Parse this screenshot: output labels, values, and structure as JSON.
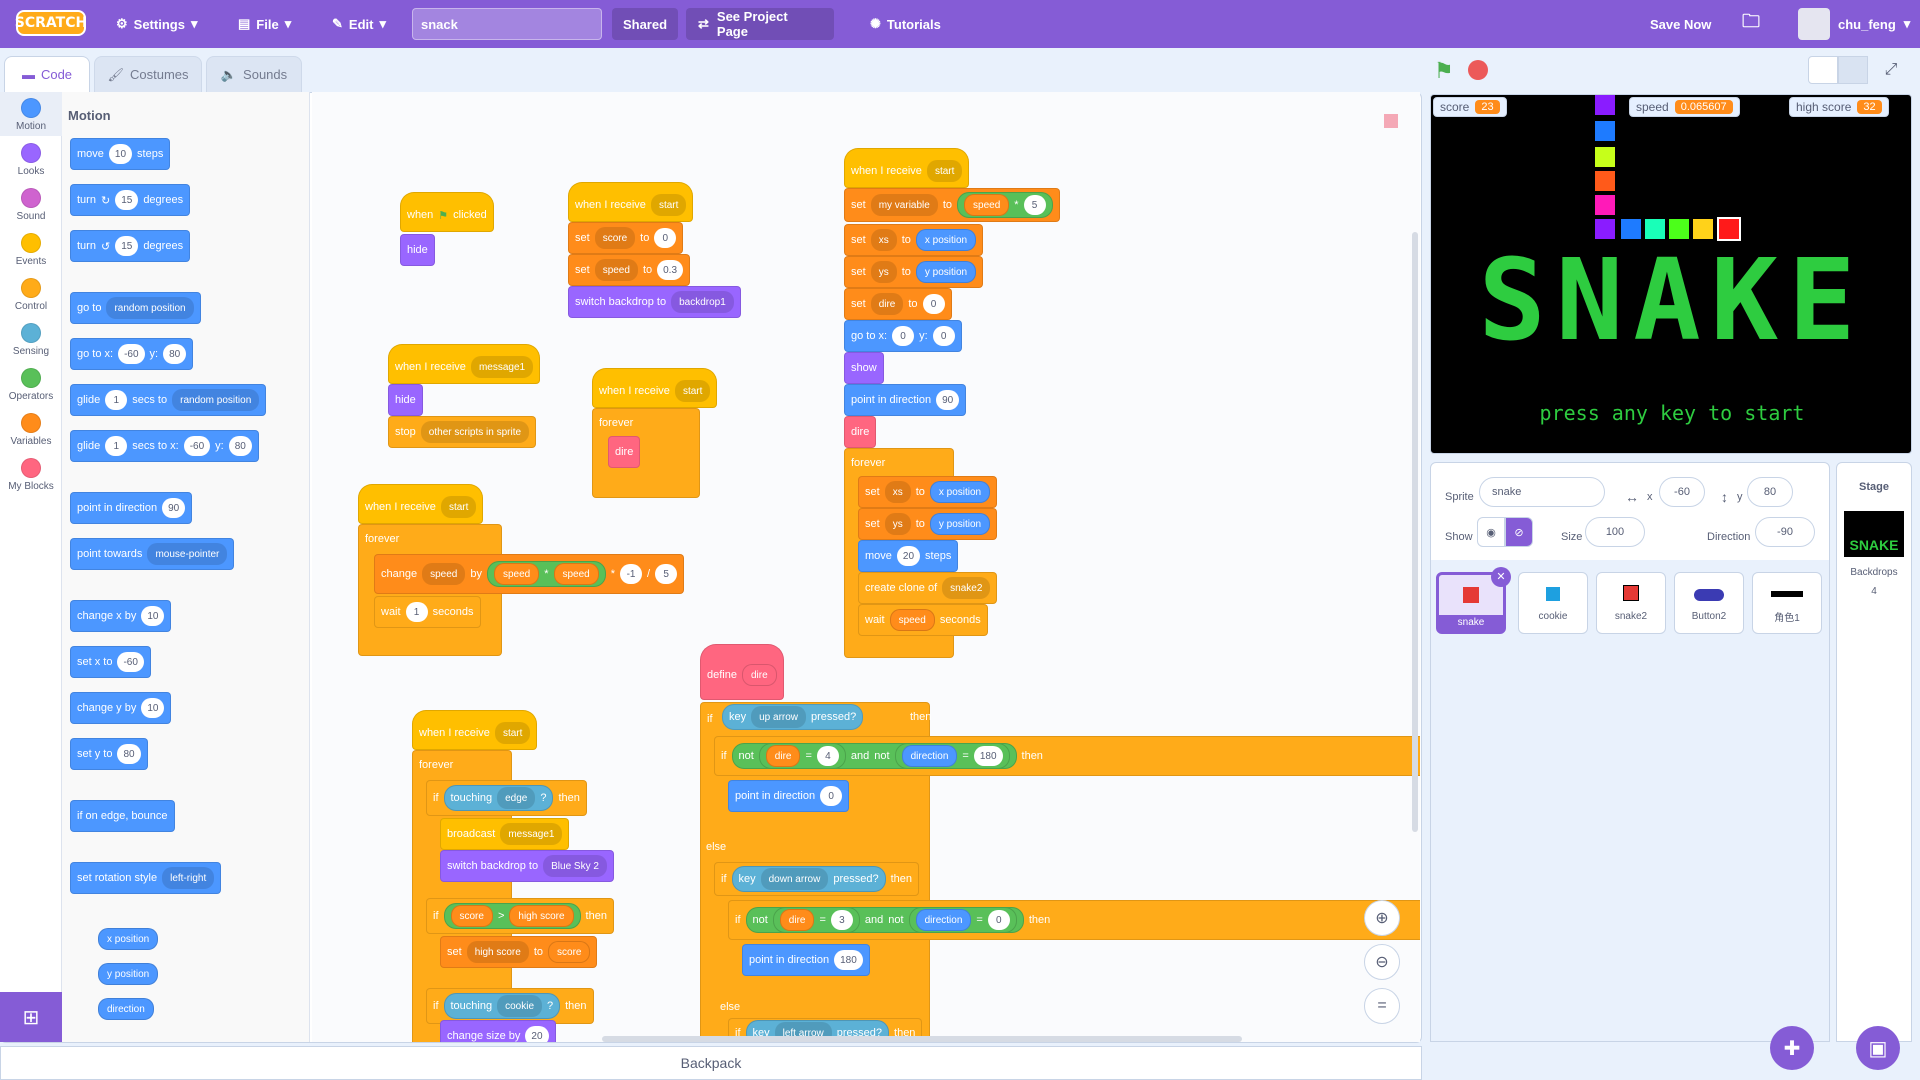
{
  "menubar": {
    "logo": "SCRATCH",
    "settings": "Settings",
    "file": "File",
    "edit": "Edit",
    "project_title": "snack",
    "shared": "Shared",
    "see_project": "See Project Page",
    "tutorials": "Tutorials",
    "save_now": "Save Now",
    "username": "chu_feng"
  },
  "tabs": {
    "code": "Code",
    "costumes": "Costumes",
    "sounds": "Sounds"
  },
  "categories": [
    {
      "label": "Motion",
      "color": "#4c97ff"
    },
    {
      "label": "Looks",
      "color": "#9966ff"
    },
    {
      "label": "Sound",
      "color": "#cf63cf"
    },
    {
      "label": "Events",
      "color": "#ffbf00"
    },
    {
      "label": "Control",
      "color": "#ffab19"
    },
    {
      "label": "Sensing",
      "color": "#5cb1d6"
    },
    {
      "label": "Operators",
      "color": "#59c059"
    },
    {
      "label": "Variables",
      "color": "#ff8c1a"
    },
    {
      "label": "My Blocks",
      "color": "#ff6680"
    }
  ],
  "palette": {
    "heading": "Motion",
    "move": "move",
    "move_n": "10",
    "steps": "steps",
    "turn": "turn",
    "turn_n": "15",
    "degrees": "degrees",
    "goto": "go to",
    "random_position": "random position",
    "goto_x": "go to x:",
    "gx": "-60",
    "y": "y:",
    "gy": "80",
    "glide": "glide",
    "glide_n": "1",
    "secs_to": "secs to",
    "secs_to_x": "secs to x:",
    "point_dir": "point in direction",
    "dir_n": "90",
    "point_towards": "point towards",
    "mouse_pointer": "mouse-pointer",
    "change_x": "change x by",
    "change_x_n": "10",
    "set_x": "set x to",
    "set_x_n": "-60",
    "change_y": "change y by",
    "change_y_n": "10",
    "set_y": "set y to",
    "set_y_n": "80",
    "bounce": "if on edge, bounce",
    "rotation": "set rotation style",
    "left_right": "left-right",
    "xpos": "x position",
    "ypos": "y position",
    "direction": "direction"
  },
  "scripts": {
    "when": "when",
    "clicked": "clicked",
    "hide": "hide",
    "show": "show",
    "when_receive": "when I receive",
    "start": "start",
    "message1": "message1",
    "set": "set",
    "to": "to",
    "score": "score",
    "zero": "0",
    "speed": "speed",
    "speed_v": "0.3",
    "switch_backdrop": "switch backdrop to",
    "backdrop1": "backdrop1",
    "stop": "stop",
    "other_scripts": "other scripts in sprite",
    "forever": "forever",
    "dire": "dire",
    "change": "change",
    "by": "by",
    "times": "*",
    "neg1": "-1",
    "div": "/",
    "five": "5",
    "wait": "wait",
    "one": "1",
    "seconds": "seconds",
    "my_variable": "my variable",
    "xs": "xs",
    "ys": "ys",
    "x_position": "x position",
    "y_position": "y position",
    "goto_x": "go to x:",
    "y_colon": "y:",
    "point_in_direction": "point in direction",
    "ninety": "90",
    "move": "move",
    "twenty": "20",
    "steps": "steps",
    "create_clone": "create clone of",
    "snake2": "snake2",
    "define": "define",
    "if": "if",
    "then": "then",
    "else": "else",
    "touching": "touching",
    "edge": "edge",
    "q": "?",
    "broadcast": "broadcast",
    "blue_sky": "Blue Sky 2",
    "gt": ">",
    "high_score": "high score",
    "cookie": "cookie",
    "change_size": "change size by",
    "size_n": "20",
    "key": "key",
    "up_arrow": "up arrow",
    "down_arrow": "down arrow",
    "left_arrow": "left arrow",
    "pressed": "pressed?",
    "not": "not",
    "eq": "=",
    "four": "4",
    "and": "and",
    "direction": "direction",
    "d180": "180",
    "three": "3"
  },
  "stage": {
    "score_label": "score",
    "score": "23",
    "speed_label": "speed",
    "speed": "0.065607",
    "high_label": "high score",
    "high": "32",
    "big_title": "SNAKE",
    "prompt": "press any key to start"
  },
  "sprite_info": {
    "sprite_label": "Sprite",
    "sprite_name": "snake",
    "x_label": "x",
    "x": "-60",
    "y_label": "y",
    "y": "80",
    "show_label": "Show",
    "size_label": "Size",
    "size": "100",
    "direction_label": "Direction",
    "direction": "-90"
  },
  "sprites": [
    "snake",
    "cookie",
    "snake2",
    "Button2",
    "角色1"
  ],
  "stage_panel": {
    "label": "Stage",
    "backdrops_label": "Backdrops",
    "backdrops": "4",
    "thumb_text": "SNAKE"
  },
  "backpack": "Backpack",
  "colors": {
    "accent": "#855cd6",
    "motion": "#4c97ff",
    "events": "#ffbf00",
    "control": "#ffab19",
    "operators": "#59c059",
    "variables": "#ff8c1a",
    "sensing": "#5cb1d6",
    "looks": "#9966ff",
    "myblocks": "#ff6680",
    "snake_green": "#2ecc40"
  }
}
